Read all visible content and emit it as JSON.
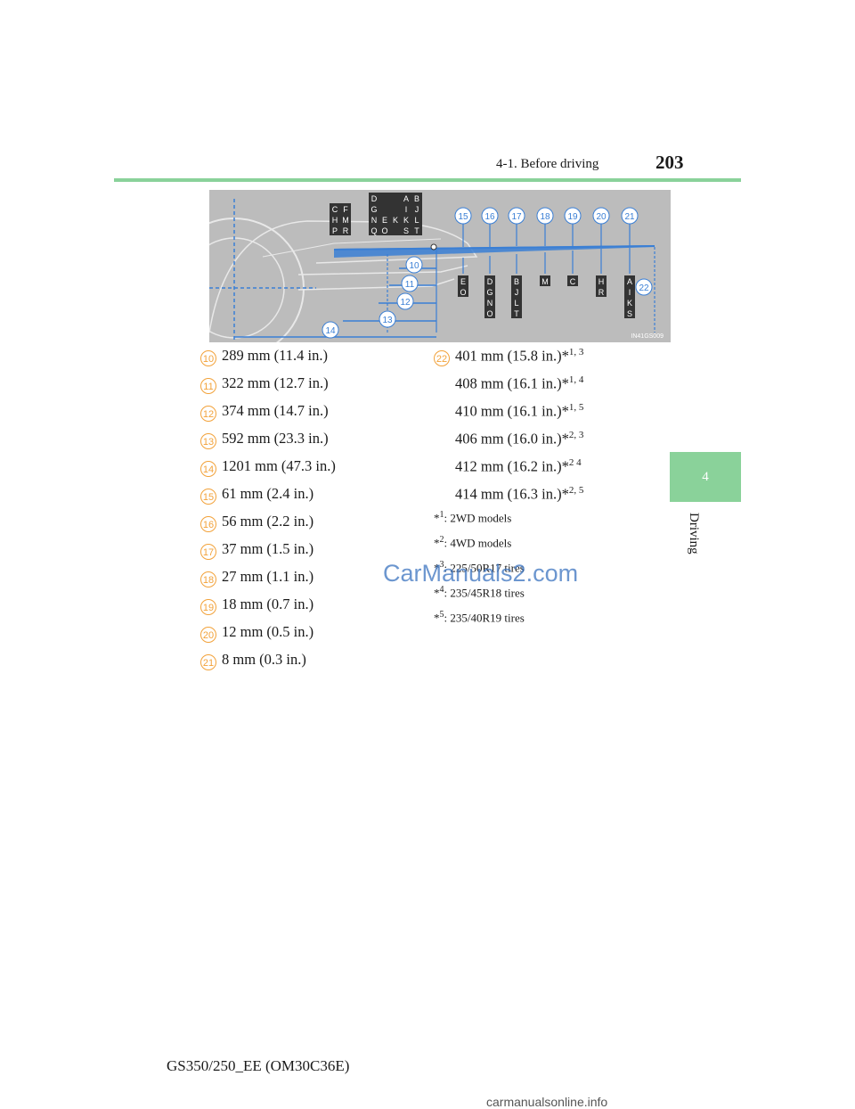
{
  "header": {
    "section": "4-1. Before driving",
    "page_number": "203"
  },
  "side_tab": {
    "number": "4",
    "label": "Driving"
  },
  "figure": {
    "code": "IN41GS009",
    "top_callouts": [
      "15",
      "16",
      "17",
      "18",
      "19",
      "20",
      "21"
    ],
    "left_callouts": [
      "10",
      "11",
      "12",
      "13",
      "14"
    ],
    "right_callout": "22",
    "letter_grid_left": [
      "C",
      "F",
      "H",
      "M",
      "P",
      "R"
    ],
    "letter_grid_mid": [
      "D",
      "G",
      "N",
      "E",
      "K",
      "L",
      "Q",
      "O",
      "S",
      "T"
    ],
    "letter_grid_right": [
      "A",
      "B",
      "I",
      "J",
      "K",
      "L",
      "S",
      "T"
    ],
    "letter_columns": [
      [
        "E",
        "O"
      ],
      [
        "D",
        "G",
        "N",
        "O"
      ],
      [
        "B",
        "J",
        "L",
        "T"
      ],
      [
        "M"
      ],
      [
        "C"
      ],
      [
        "H",
        "R"
      ],
      [
        "A",
        "I",
        "K",
        "S"
      ]
    ]
  },
  "left_list": [
    {
      "num": "10",
      "text": "289 mm (11.4 in.)"
    },
    {
      "num": "11",
      "text": "322 mm (12.7 in.)"
    },
    {
      "num": "12",
      "text": "374 mm (14.7 in.)"
    },
    {
      "num": "13",
      "text": "592 mm (23.3 in.)"
    },
    {
      "num": "14",
      "text": "1201 mm (47.3 in.)"
    },
    {
      "num": "15",
      "text": "61 mm (2.4 in.)"
    },
    {
      "num": "16",
      "text": "56 mm (2.2 in.)"
    },
    {
      "num": "17",
      "text": "37 mm (1.5 in.)"
    },
    {
      "num": "18",
      "text": "27 mm (1.1 in.)"
    },
    {
      "num": "19",
      "text": "18 mm (0.7 in.)"
    },
    {
      "num": "20",
      "text": "12 mm (0.5 in.)"
    },
    {
      "num": "21",
      "text": "8 mm (0.3 in.)"
    }
  ],
  "right_list": {
    "num": "22",
    "items": [
      {
        "text": "401 mm (15.8 in.)*",
        "sup": "1, 3"
      },
      {
        "text": "408 mm (16.1 in.)*",
        "sup": "1, 4"
      },
      {
        "text": "410 mm (16.1 in.)*",
        "sup": "1, 5"
      },
      {
        "text": "406 mm (16.0 in.)*",
        "sup": "2, 3"
      },
      {
        "text": "412 mm (16.2 in.)*",
        "sup": "2 4"
      },
      {
        "text": "414 mm (16.3 in.)*",
        "sup": "2, 5"
      }
    ]
  },
  "notes": [
    {
      "mark": "*",
      "sup": "1",
      "text": ": 2WD models"
    },
    {
      "mark": "*",
      "sup": "2",
      "text": ": 4WD models"
    },
    {
      "mark": "*",
      "sup": "3",
      "text": ": 225/50R17 tires"
    },
    {
      "mark": "*",
      "sup": "4",
      "text": ": 235/45R18 tires"
    },
    {
      "mark": "*",
      "sup": "5",
      "text": ": 235/40R19 tires"
    }
  ],
  "footer": "GS350/250_EE (OM30C36E)",
  "watermark": "CarManuals2.com",
  "watermark_bottom": "carmanualsonline.info",
  "colors": {
    "accent_green": "#8ad29a",
    "callout_orange": "#f2a23a",
    "figure_bg": "#bcbcbc",
    "diagram_blue": "#3a7fd5"
  }
}
